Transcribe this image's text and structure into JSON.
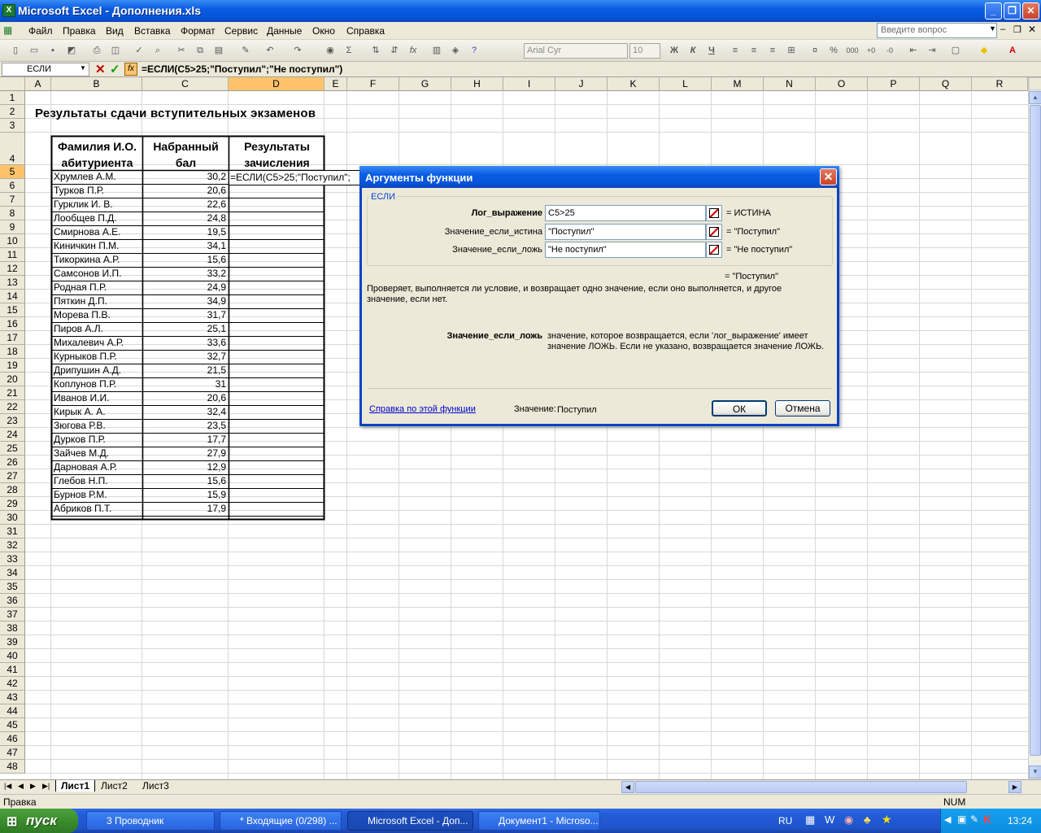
{
  "window": {
    "title": "Microsoft Excel - Дополнения.xls"
  },
  "menu": [
    "Файл",
    "Правка",
    "Вид",
    "Вставка",
    "Формат",
    "Сервис",
    "Данные",
    "Окно",
    "Справка"
  ],
  "ask_placeholder": "Введите вопрос",
  "toolbar": {
    "font": "Arial Cyr",
    "size": "10",
    "bold": "Ж",
    "italic": "К",
    "underline": "Ч"
  },
  "namebox": "ЕСЛИ",
  "formula": "=ЕСЛИ(C5>25;\"Поступил\";\"Не поступил\")",
  "columns": [
    "A",
    "B",
    "C",
    "D",
    "E",
    "F",
    "G",
    "H",
    "I",
    "J",
    "K",
    "L",
    "M",
    "N",
    "O",
    "P",
    "Q",
    "R"
  ],
  "rows": [
    "1",
    "2",
    "3",
    "4",
    "5",
    "6",
    "7",
    "8",
    "9",
    "10",
    "11",
    "12",
    "13",
    "14",
    "15",
    "16",
    "17",
    "18",
    "19",
    "20",
    "21",
    "22",
    "23",
    "24",
    "25",
    "26",
    "27",
    "28",
    "29",
    "30",
    "31",
    "32",
    "33",
    "34",
    "35",
    "36",
    "37",
    "38",
    "39",
    "40",
    "41",
    "42",
    "43",
    "44",
    "45",
    "46",
    "47",
    "48"
  ],
  "sheet": {
    "title": "Результаты сдачи вступительных экзаменов",
    "header_b1": "Фамилия И.О.",
    "header_b2": "абитуриента",
    "header_c1": "Набранный",
    "header_c2": "бал",
    "header_d1": "Результаты",
    "header_d2": "зачисления",
    "edit_text": "=ЕСЛИ(C5>25;\"Поступил\";",
    "data": [
      [
        "Хрумлев А.М.",
        "30,2"
      ],
      [
        "Турков П.Р.",
        "20,6"
      ],
      [
        "Гурклик И. В.",
        "22,6"
      ],
      [
        "Лообщев П.Д.",
        "24,8"
      ],
      [
        "Смирнова А.Е.",
        "19,5"
      ],
      [
        "Киничкин П.М.",
        "34,1"
      ],
      [
        "Тикоркина А.Р.",
        "15,6"
      ],
      [
        "Самсонов И.П.",
        "33,2"
      ],
      [
        "Родная П.Р.",
        "24,9"
      ],
      [
        "Пяткин Д.П.",
        "34,9"
      ],
      [
        "Морева П.В.",
        "31,7"
      ],
      [
        "Пиров А.Л.",
        "25,1"
      ],
      [
        "Михалевич А.Р.",
        "33,6"
      ],
      [
        "Курныков П.Р.",
        "32,7"
      ],
      [
        "Дрипушин А.Д.",
        "21,5"
      ],
      [
        "Коплунов П.Р.",
        "31"
      ],
      [
        "Иванов И.И.",
        "20,6"
      ],
      [
        "Кирык А. А.",
        "32,4"
      ],
      [
        "Зюгова Р.В.",
        "23,5"
      ],
      [
        "Дурков П.Р.",
        "17,7"
      ],
      [
        "Зайчев М.Д.",
        "27,9"
      ],
      [
        "Дарновая А.Р.",
        "12,9"
      ],
      [
        "Глебов Н.П.",
        "15,6"
      ],
      [
        "Бурнов Р.М.",
        "15,9"
      ],
      [
        "Абриков П.Т.",
        "17,9"
      ]
    ]
  },
  "tabs": [
    "Лист1",
    "Лист2",
    "Лист3"
  ],
  "status": {
    "left": "Правка",
    "num": "NUM"
  },
  "dialog": {
    "title": "Аргументы функции",
    "group": "ЕСЛИ",
    "args": [
      {
        "label": "Лог_выражение",
        "value": "C5>25",
        "result": "= ИСТИНА"
      },
      {
        "label": "Значение_если_истина",
        "value": "\"Поступил\"",
        "result": "= \"Поступил\""
      },
      {
        "label": "Значение_если_ложь",
        "value": "\"Не поступил\"",
        "result": "= \"Не поступил\""
      }
    ],
    "total": "= \"Поступил\"",
    "desc": "Проверяет, выполняется ли условие, и возвращает одно значение, если оно выполняется, и другое значение, если нет.",
    "arg_name": "Значение_если_ложь",
    "arg_desc": "значение, которое возвращается, если 'лог_выражение' имеет значение ЛОЖЬ. Если не указано, возвращается значение ЛОЖЬ.",
    "help": "Справка по этой функции",
    "value_label": "Значение:",
    "value": "Поступил",
    "ok": "ОК",
    "cancel": "Отмена"
  },
  "taskbar": {
    "start": "пуск",
    "items": [
      "3 Проводник",
      "* Входящие (0/298) ...",
      "Microsoft Excel - Доп...",
      "Документ1 - Microso..."
    ],
    "lang": "RU",
    "time": "13:24"
  }
}
